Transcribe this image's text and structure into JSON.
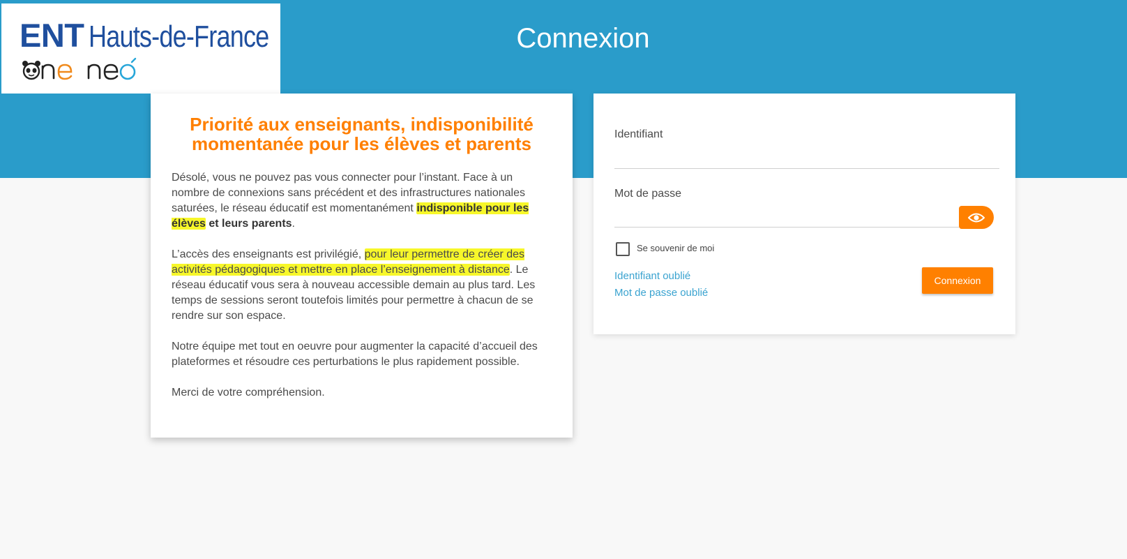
{
  "header": {
    "logo_brand_bold": "ENT",
    "logo_brand_rest": "Hauts-de-France",
    "logo_sub": "one neo",
    "title": "Connexion"
  },
  "notice": {
    "title_line1": "Priorité aux enseignants, indisponibilité",
    "title_line2": "momentanée pour les élèves et parents",
    "p1_text": "Désolé, vous ne pouvez pas vous connecter pour l’instant. Face à un nombre de connexions sans précédent et des infrastructures nationales saturées, le réseau éducatif est momentanément ",
    "p1_highlight": "indisponible pour les élèves",
    "p1_bold_rest": " et leurs parents",
    "p1_end": ".",
    "p2_text": "L’accès des enseignants est privilégié, ",
    "p2_highlight": "pour leur permettre de créer des activités pédagogiques et mettre en place l’enseignement à distance",
    "p2_rest": ". Le réseau éducatif vous sera à nouveau accessible demain au plus tard. Les temps de sessions seront toutefois limités pour permettre à chacun de se rendre sur son espace.",
    "p3": "Notre équipe met tout en oeuvre pour augmenter la capacité d’accueil des plateformes et résoudre ces perturbations le plus rapidement possible.",
    "p4": "Merci de votre compréhension."
  },
  "login": {
    "username_label": "Identifiant",
    "username_value": "",
    "password_label": "Mot de passe",
    "password_value": "",
    "remember_label": "Se souvenir de moi",
    "remember_checked": false,
    "forgot_username": "Identifiant oublié",
    "forgot_password": "Mot de passe oublié",
    "submit_label": "Connexion",
    "show_password_icon": "eye-icon"
  },
  "colors": {
    "header_blue": "#2a9cca",
    "accent_orange": "#ff8000",
    "title_orange": "#ff7f00",
    "link_blue": "#3aa3d0",
    "highlight_yellow": "#f7f72a",
    "logo_navy": "#1f4f9e"
  }
}
